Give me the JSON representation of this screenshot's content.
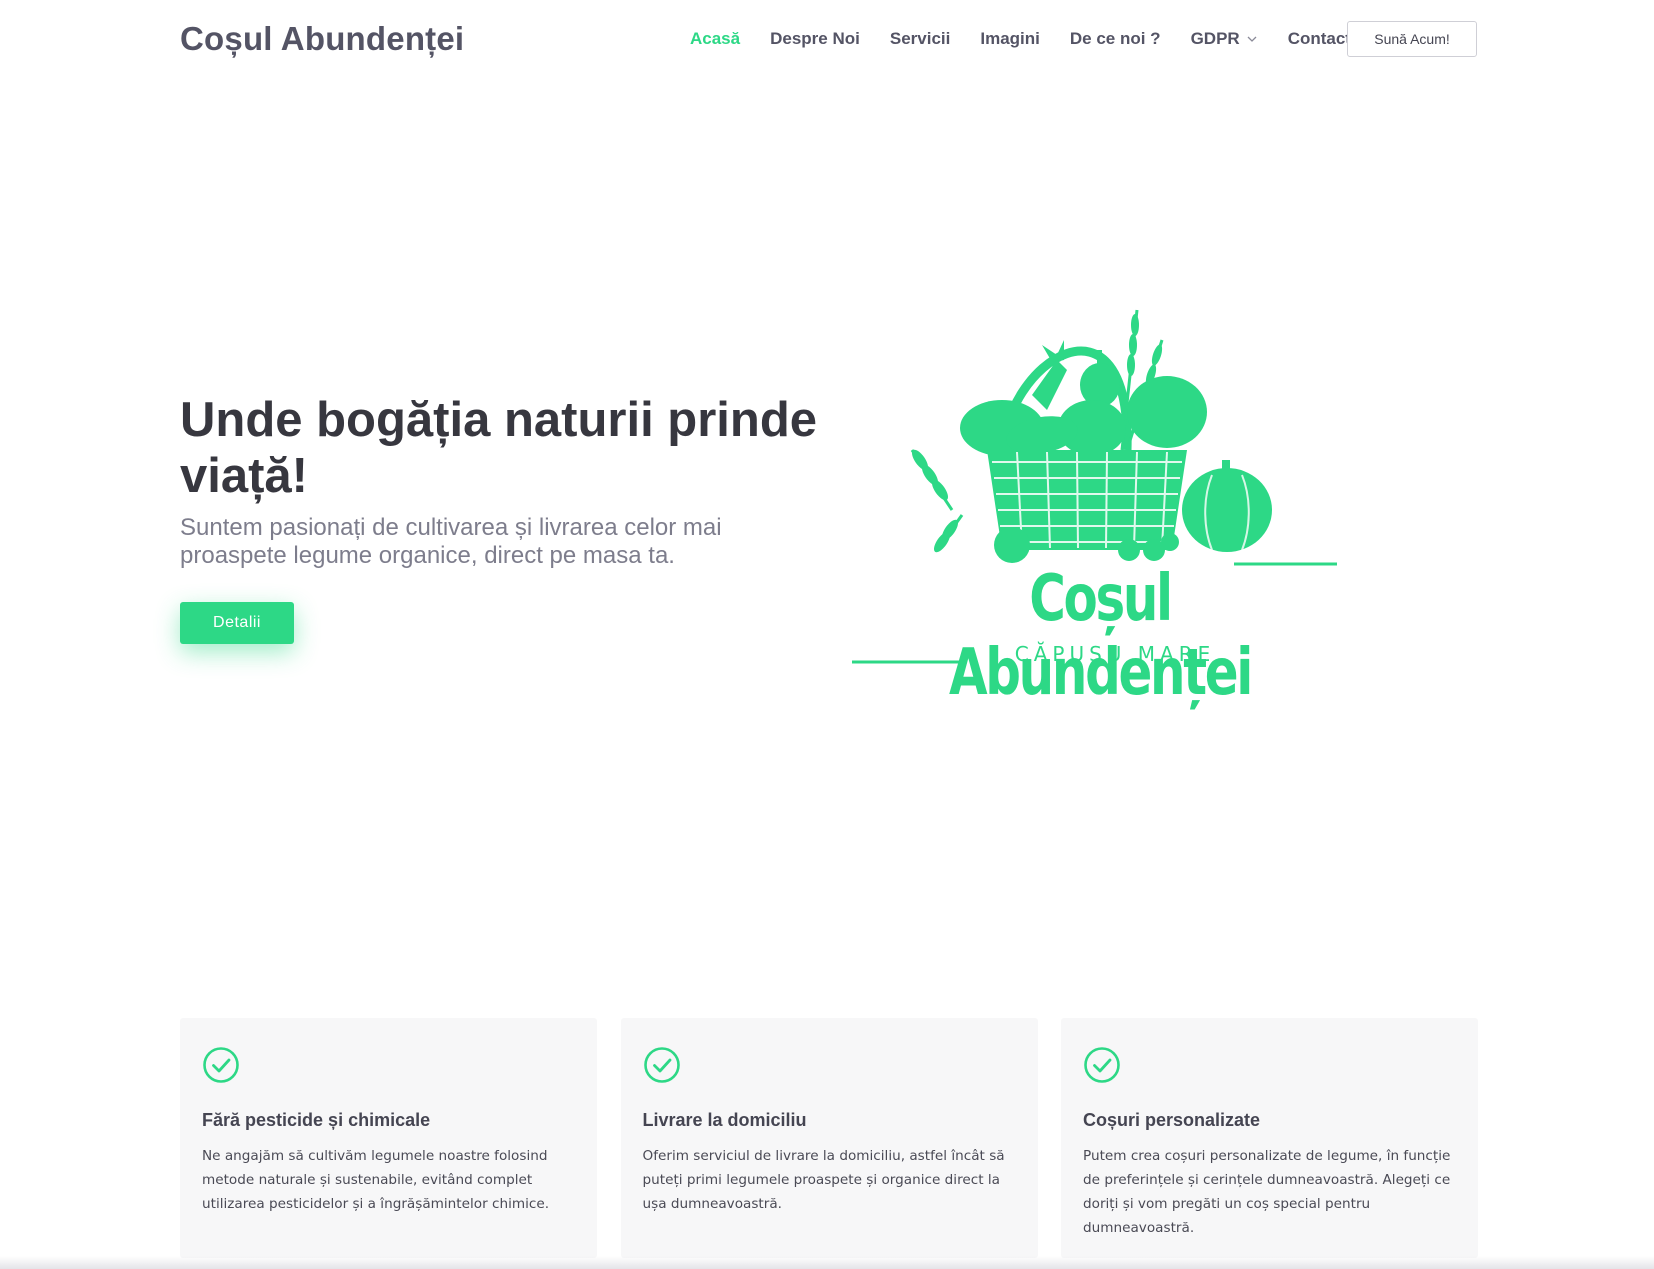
{
  "header": {
    "brand": "Coșul Abundenței",
    "nav": [
      {
        "label": "Acasă",
        "active": true
      },
      {
        "label": "Despre Noi",
        "active": false
      },
      {
        "label": "Servicii",
        "active": false
      },
      {
        "label": "Imagini",
        "active": false
      },
      {
        "label": "De ce noi ?",
        "active": false
      },
      {
        "label": "GDPR",
        "active": false,
        "dropdown": true
      },
      {
        "label": "Contact",
        "active": false
      }
    ],
    "call_button": "Sună Acum!"
  },
  "hero": {
    "title": "Unde bogăția naturii prinde viață!",
    "subtitle": "Suntem pasionați de cultivarea și livrarea celor mai proaspete legume organice, direct pe masa ta.",
    "button": "Detalii",
    "logo": {
      "name": "Coșul Abundenței",
      "place": "CĂPUȘU MARE",
      "icon": "vegetable-basket-icon"
    }
  },
  "features": [
    {
      "icon": "check-circle-icon",
      "title": "Fără pesticide și chimicale",
      "text": "Ne angajăm să cultivăm legumele noastre folosind metode naturale și sustenabile, evitând complet utilizarea pesticidelor și a îngrășămintelor chimice."
    },
    {
      "icon": "check-circle-icon",
      "title": "Livrare la domiciliu",
      "text": "Oferim serviciul de livrare la domiciliu, astfel încât să puteți primi legumele proaspete și organice direct la ușa dumneavoastră."
    },
    {
      "icon": "check-circle-icon",
      "title": "Coșuri personalizate",
      "text": "Putem crea coșuri personalizate de legume, în funcție de preferințele și cerințele dumneavoastră. Alegeți ce doriți și vom pregăti un coș special pentru dumneavoastră."
    }
  ],
  "colors": {
    "accent": "#2dd886",
    "heading": "#37373f",
    "nav_text": "#545465",
    "subtitle": "#7d7d8c",
    "card_bg": "#f7f7f8"
  }
}
